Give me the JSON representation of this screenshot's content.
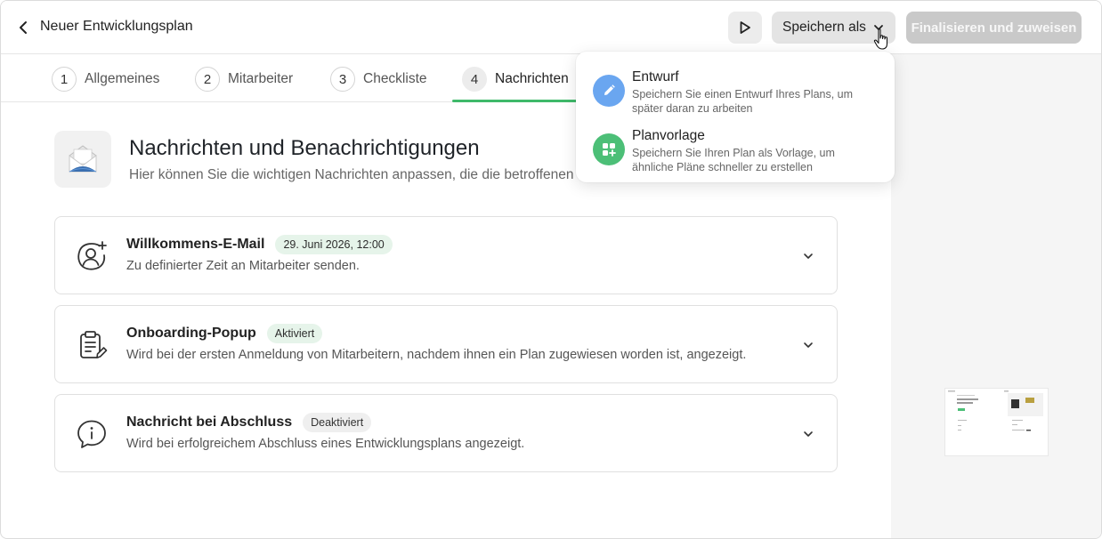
{
  "header": {
    "title": "Neuer Entwicklungsplan",
    "save_as_label": "Speichern als",
    "finalize_label": "Finalisieren und zuweisen"
  },
  "tabs": [
    {
      "number": "1",
      "label": "Allgemeines"
    },
    {
      "number": "2",
      "label": "Mitarbeiter"
    },
    {
      "number": "3",
      "label": "Checkliste"
    },
    {
      "number": "4",
      "label": "Nachrichten"
    }
  ],
  "active_tab": "Nachrichten",
  "section": {
    "title": "Nachrichten und Benachrichtigungen",
    "subtitle": "Hier können Sie die wichtigen Nachrichten anpassen, die die betroffenen Pe"
  },
  "cards": [
    {
      "title": "Willkommens-E-Mail",
      "badge": "29. Juni 2026, 12:00",
      "description": "Zu definierter Zeit an Mitarbeiter senden.",
      "icon": "user-plus-icon"
    },
    {
      "title": "Onboarding-Popup",
      "badge": "Aktiviert",
      "description": "Wird bei der ersten Anmeldung von Mitarbeitern, nachdem ihnen ein Plan zugewiesen worden ist, angezeigt.",
      "icon": "clipboard-edit-icon"
    },
    {
      "title": "Nachricht bei Abschluss",
      "badge": "Deaktiviert",
      "description": "Wird bei erfolgreichem Abschluss eines Entwicklungsplans angezeigt.",
      "icon": "info-chat-icon"
    }
  ],
  "dropdown": {
    "items": [
      {
        "title": "Entwurf",
        "description": "Speichern Sie einen Entwurf Ihres Plans, um später daran zu arbeiten",
        "icon": "pencil-icon",
        "color": "#6aa6f0"
      },
      {
        "title": "Planvorlage",
        "description": "Speichern Sie Ihren Plan als Vorlage, um ähnliche Pläne schneller zu erstellen",
        "icon": "template-add-icon",
        "color": "#4cbf77"
      }
    ]
  },
  "colors": {
    "accent": "#3fb96a",
    "active_badge_bg": "#e6f4ea",
    "inactive_badge_bg": "#efefef",
    "finalize_disabled_bg": "#c9c9c9"
  }
}
